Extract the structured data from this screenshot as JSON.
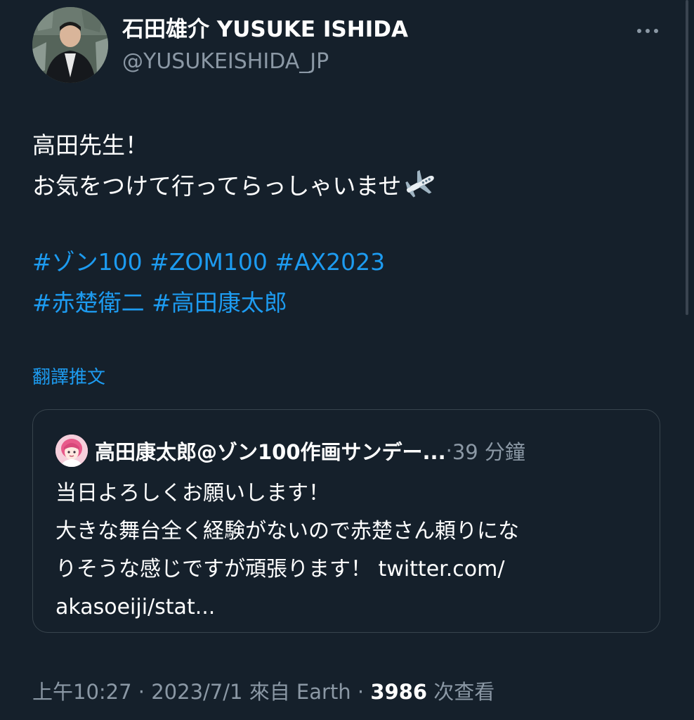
{
  "author": {
    "display_name": "石田雄介 YUSUKE ISHIDA",
    "handle": "@YUSUKEISHIDA_JP"
  },
  "tweet": {
    "lines": [
      "高田先生！",
      "お気をつけて行ってらっしゃいませ"
    ],
    "emoji": "airplane",
    "hashtag_rows": [
      [
        "#ゾン100",
        "#ZOM100",
        "#AX2023"
      ],
      [
        "#赤楚衛二",
        "#高田康太郎"
      ]
    ]
  },
  "translate_label": "翻譯推文",
  "quoted_tweet": {
    "author": "高田康太郎@ゾン100作画サンデー...",
    "separator": " · ",
    "time": "39 分鐘",
    "lines": [
      "当日よろしくお願いします！",
      "大きな舞台全く経験がないので赤楚さん頼りにな",
      "りそうな感じですが頑張ります！ twitter.com/",
      "akasoeiji/stat..."
    ]
  },
  "meta": {
    "time": "上午10:27",
    "date": "2023/7/1",
    "source": "來自 Earth",
    "separator": " · ",
    "views_count": "3986",
    "views_label": "次查看"
  },
  "colors": {
    "background": "#15202b",
    "text": "#ffffff",
    "secondary_text": "#8b98a5",
    "link": "#1d9bf0",
    "border": "#38444d"
  },
  "icons": {
    "more": "more-horizontal-icon",
    "plane": "airplane-emoji-icon"
  }
}
